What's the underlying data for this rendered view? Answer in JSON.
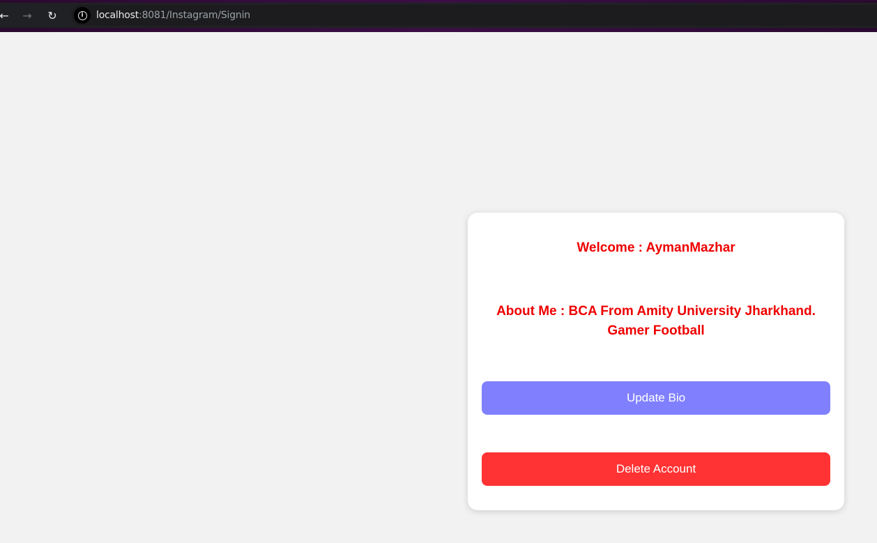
{
  "browser": {
    "url_host": "localhost",
    "url_rest": ":8081/Instagram/Signin",
    "back_icon": "arrow-left",
    "forward_icon": "arrow-right",
    "reload_icon": "reload",
    "site_info_icon": "info"
  },
  "profile": {
    "welcome": "Welcome : AymanMazhar",
    "about_line1": "About Me : BCA From Amity University Jharkhand.",
    "about_line2": "Gamer Football"
  },
  "actions": {
    "update_label": "Update Bio",
    "delete_label": "Delete Account"
  },
  "colors": {
    "text_accent": "#ee0000",
    "update_button": "#8080ff",
    "delete_button": "#ff3333",
    "page_background": "#f2f2f2"
  }
}
